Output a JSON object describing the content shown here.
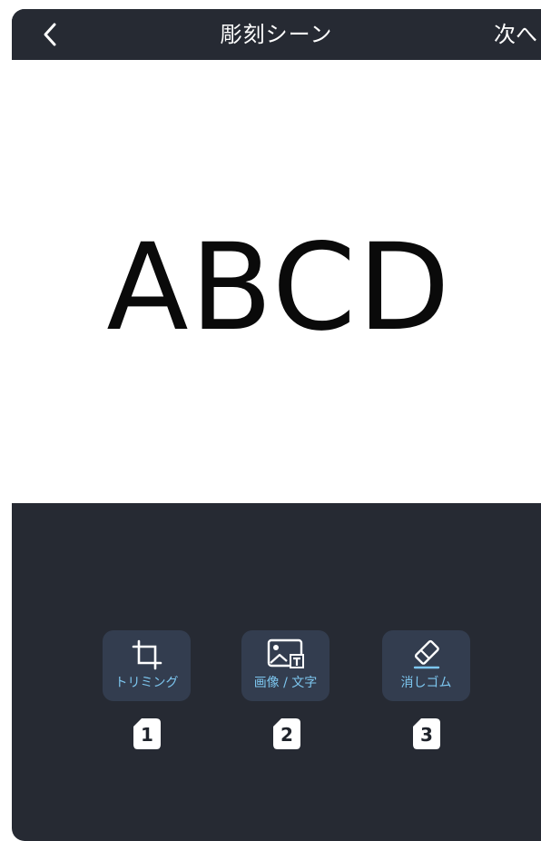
{
  "header": {
    "title": "彫刻シーン",
    "next_label": "次へ"
  },
  "canvas": {
    "text": "ABCD"
  },
  "tools": [
    {
      "label": "トリミング",
      "number": "1",
      "icon": "crop-icon"
    },
    {
      "label": "画像 / 文字",
      "number": "2",
      "icon": "image-text-icon"
    },
    {
      "label": "消しゴム",
      "number": "3",
      "icon": "eraser-icon"
    }
  ],
  "colors": {
    "background": "#262a33",
    "canvas": "#ffffff",
    "tool_button": "#333d4f",
    "accent": "#7dc6ef"
  }
}
